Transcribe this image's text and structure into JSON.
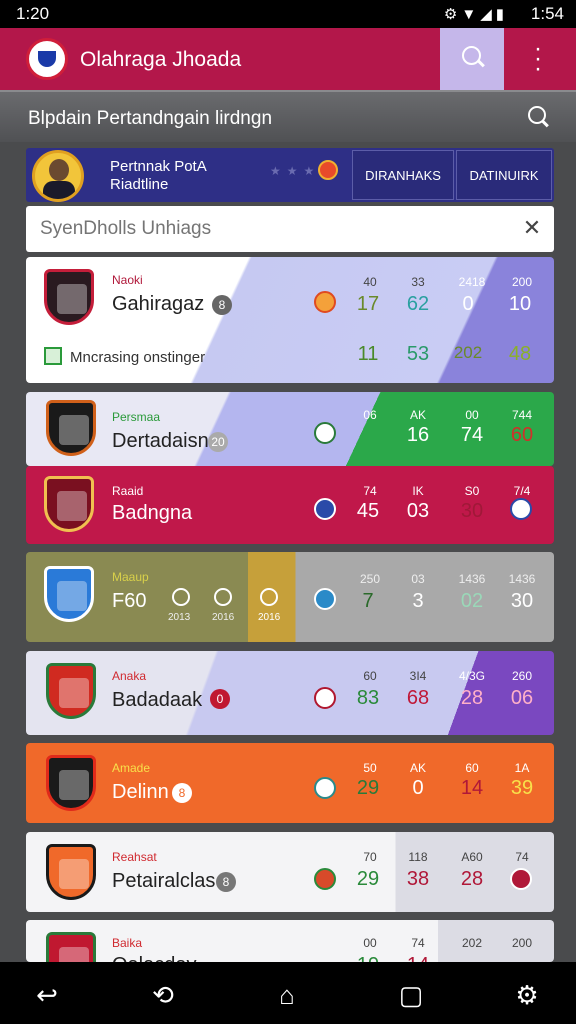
{
  "status": {
    "time_left": "1:20",
    "time_right": "1:54",
    "icons": "⚙▼◢▮"
  },
  "app": {
    "title": "Olahraga Jhoada"
  },
  "subheader": {
    "title": "Blpdain Pertandngain lirdngn"
  },
  "banner": {
    "line1": "Pertnnak PotA",
    "line2": "Riadtline",
    "button1": "DIRANHAKS",
    "button2": "DATINUIRK"
  },
  "search": {
    "placeholder": "SyenDholls Unhiags"
  },
  "rows": [
    {
      "league": "Naoki",
      "name": "Gahiragaz",
      "badge": "8",
      "headers": [
        "40",
        "33",
        "2418",
        "200"
      ],
      "values": [
        "17",
        "62",
        "0",
        "10"
      ],
      "sub_label": "Mncrasing onstinger",
      "sub_values": [
        "11",
        "53",
        "202",
        "48"
      ]
    },
    {
      "league": "Persmaa",
      "name": "Dertadaisn",
      "badge": "20",
      "headers": [
        "06",
        "AK",
        "00",
        "744"
      ],
      "values": [
        "16",
        "74",
        "60"
      ]
    },
    {
      "league": "Raaid",
      "name": "Badngna",
      "headers": [
        "74",
        "IK",
        "S0",
        "7/4"
      ],
      "values": [
        "45",
        "03",
        "30"
      ]
    },
    {
      "league": "Maaup",
      "name": "F60",
      "extra": [
        "2013",
        "2016",
        "2016"
      ],
      "headers": [
        "250",
        "03",
        "1436",
        "1436"
      ],
      "values": [
        "7",
        "3",
        "02",
        "30"
      ]
    },
    {
      "league": "Anaka",
      "name": "Badadaak",
      "badge": "0",
      "headers": [
        "60",
        "3I4",
        "4/3G",
        "260"
      ],
      "values": [
        "83",
        "68",
        "28",
        "06"
      ]
    },
    {
      "league": "Amade",
      "name": "Delinn",
      "badge": "8",
      "headers": [
        "50",
        "AK",
        "60",
        "1A"
      ],
      "values": [
        "29",
        "0",
        "14",
        "39"
      ]
    },
    {
      "league": "Reahsat",
      "name": "Petairalclas",
      "badge": "8",
      "headers": [
        "70",
        "118",
        "A60",
        "74"
      ],
      "values": [
        "29",
        "38",
        "28"
      ]
    },
    {
      "league": "Baika",
      "name": "Oalacday",
      "headers": [
        "00",
        "74",
        "202",
        "200"
      ],
      "values": [
        "19",
        "14"
      ]
    }
  ],
  "nav": {
    "back": "↩",
    "history": "⟲",
    "home": "⌂",
    "recent": "▢",
    "settings": "⚙"
  }
}
